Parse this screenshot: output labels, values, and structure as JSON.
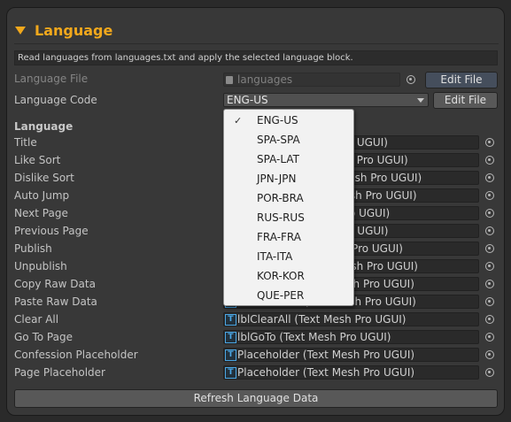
{
  "section": {
    "title": "Language"
  },
  "info_text": "Read languages from languages.txt and apply the selected language block.",
  "language_file": {
    "label": "Language File",
    "value": "languages",
    "button": "Edit File"
  },
  "language_code": {
    "label": "Language Code",
    "value": "ENG-US",
    "button": "Edit File"
  },
  "group_label": "Language",
  "rows": [
    {
      "label": "Title",
      "value": "lblTitle (Text Mesh Pro UGUI)"
    },
    {
      "label": "Like Sort",
      "value": "lblLikeSort (Text Mesh Pro UGUI)"
    },
    {
      "label": "Dislike Sort",
      "value": "lblDislikeSort (Text Mesh Pro UGUI)"
    },
    {
      "label": "Auto Jump",
      "value": "lblAutoJump (Text Mesh Pro UGUI)"
    },
    {
      "label": "Next Page",
      "value": "lblNext (Text Mesh Pro UGUI)"
    },
    {
      "label": "Previous Page",
      "value": "lblPrev (Text Mesh Pro UGUI)"
    },
    {
      "label": "Publish",
      "value": "lblPublish (Text Mesh Pro UGUI)"
    },
    {
      "label": "Unpublish",
      "value": "lblUnpublish (Text Mesh Pro UGUI)"
    },
    {
      "label": "Copy Raw Data",
      "value": "lblCopyRaw (Text Mesh Pro UGUI)"
    },
    {
      "label": "Paste Raw Data",
      "value": "lblPasteRaw (Text Mesh Pro UGUI)"
    },
    {
      "label": "Clear All",
      "value": "lblClearAll (Text Mesh Pro UGUI)"
    },
    {
      "label": "Go To Page",
      "value": "lblGoTo (Text Mesh Pro UGUI)"
    },
    {
      "label": "Confession Placeholder",
      "value": "Placeholder (Text Mesh Pro UGUI)"
    },
    {
      "label": "Page Placeholder",
      "value": "Placeholder (Text Mesh Pro UGUI)"
    }
  ],
  "dropdown_options": [
    "ENG-US",
    "SPA-SPA",
    "SPA-LAT",
    "JPN-JPN",
    "POR-BRA",
    "RUS-RUS",
    "FRA-FRA",
    "ITA-ITA",
    "KOR-KOR",
    "QUE-PER"
  ],
  "selected_index": 0,
  "refresh_button": "Refresh Language Data",
  "colors": {
    "accent": "#f2a81c",
    "panel": "#383838",
    "menu": "#f2f2f2",
    "object_icon": "#4aa6e4"
  }
}
